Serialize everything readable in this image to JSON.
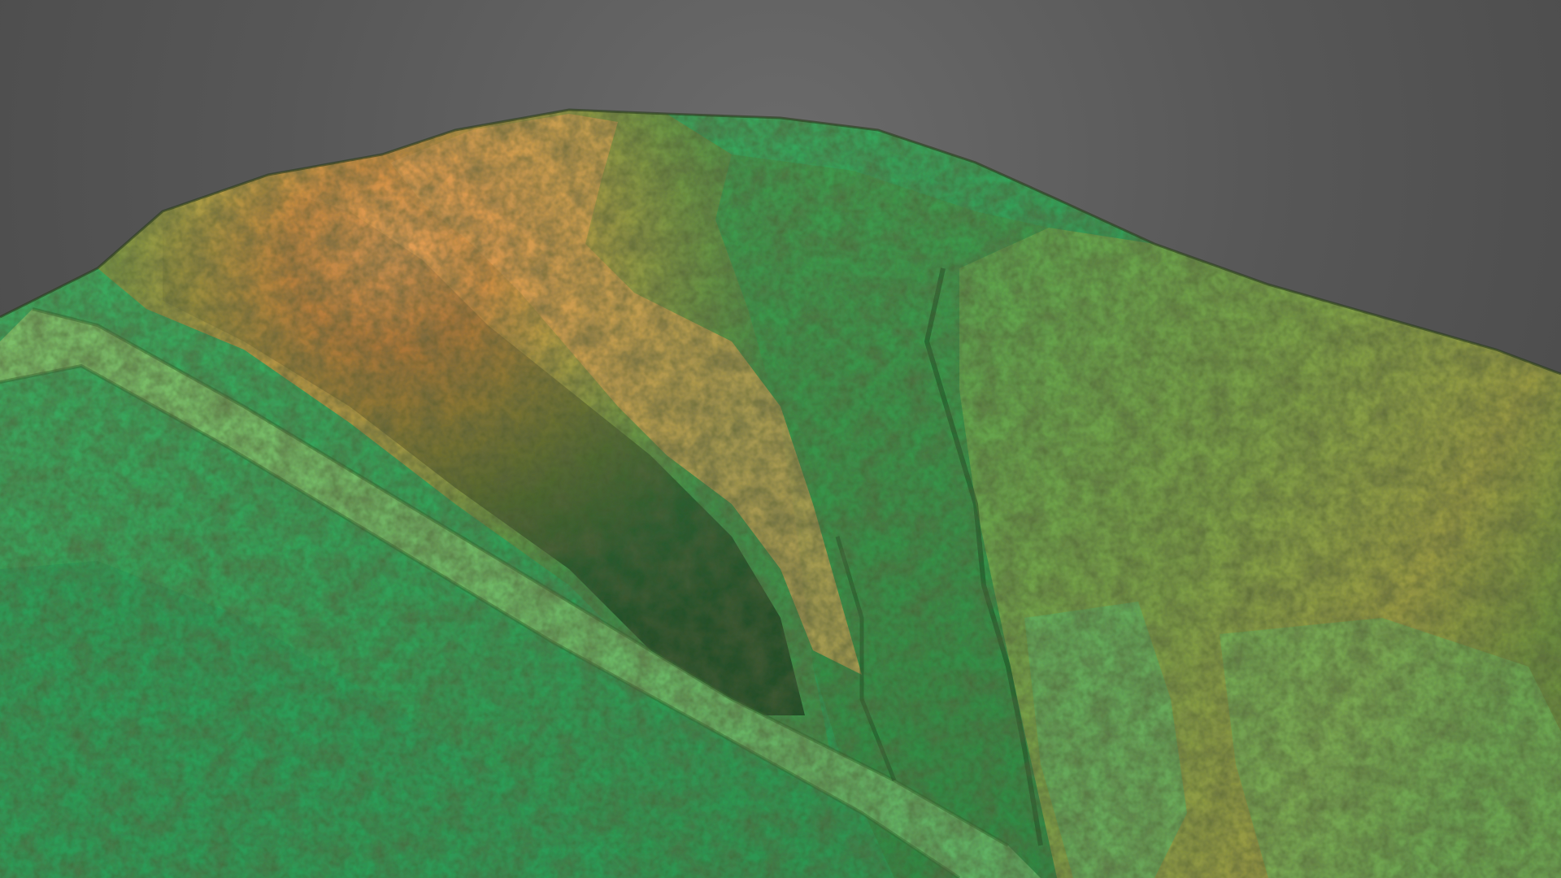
{
  "scene": {
    "background_color": "#585858",
    "palette": {
      "low_elevation": "#2f9a55",
      "mid_elevation": "#8a9a45",
      "high_elevation": "#d8924a",
      "shadow": "#1f2a14"
    }
  }
}
